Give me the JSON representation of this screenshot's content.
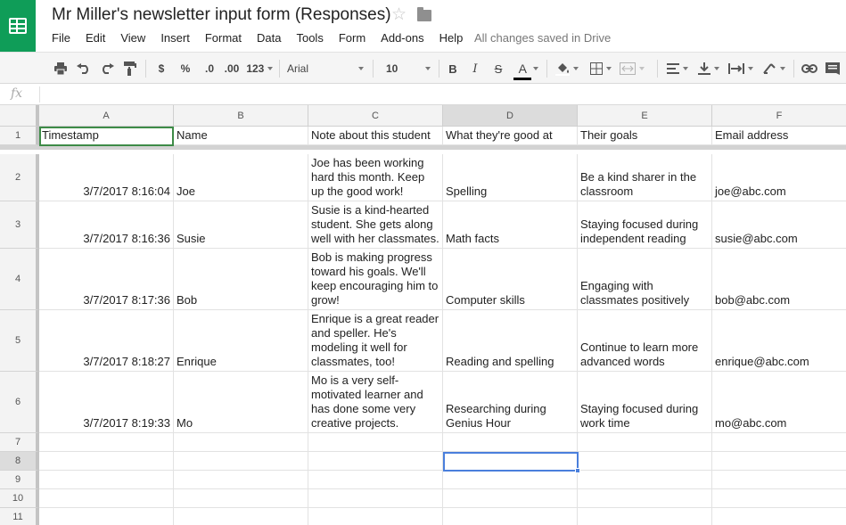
{
  "header": {
    "title": "Mr Miller's newsletter input form (Responses)",
    "save_status": "All changes saved in Drive"
  },
  "menu": [
    "File",
    "Edit",
    "View",
    "Insert",
    "Format",
    "Data",
    "Tools",
    "Form",
    "Add-ons",
    "Help"
  ],
  "toolbar": {
    "currency": "$",
    "percent": "%",
    "decrease_decimals": ".0",
    "increase_decimals": ".00",
    "more_formats": "123",
    "font": "Arial",
    "font_size": "10",
    "bold": "B",
    "italic": "I",
    "strikethrough": "S",
    "text_color": "A",
    "text_color_value": "#000000"
  },
  "formula_bar": {
    "fx": "fx",
    "content": ""
  },
  "grid": {
    "columns": [
      "A",
      "B",
      "C",
      "D",
      "E",
      "F"
    ],
    "active_column": "D",
    "active_row": "8",
    "row_numbers": [
      "1",
      "2",
      "3",
      "4",
      "5",
      "6",
      "7",
      "8",
      "9",
      "10",
      "11"
    ],
    "header_row": [
      "Timestamp",
      "Name",
      "Note about this student",
      "What they're good at",
      "Their goals",
      "Email address"
    ],
    "rows": [
      [
        "3/7/2017 8:16:04",
        "Joe",
        "Joe has been working hard this month. Keep up the good work!",
        "Spelling",
        "Be a kind sharer in the classroom",
        "joe@abc.com"
      ],
      [
        "3/7/2017 8:16:36",
        "Susie",
        "Susie is a kind-hearted student. She gets along well with her classmates.",
        "Math facts",
        "Staying focused during independent reading",
        "susie@abc.com"
      ],
      [
        "3/7/2017 8:17:36",
        "Bob",
        "Bob is making progress toward his goals. We'll keep encouraging him to grow!",
        "Computer skills",
        "Engaging with classmates positively",
        "bob@abc.com"
      ],
      [
        "3/7/2017 8:18:27",
        "Enrique",
        "Enrique is a great reader and speller. He's modeling it well for classmates, too!",
        "Reading and spelling",
        "Continue to learn more advanced words",
        "enrique@abc.com"
      ],
      [
        "3/7/2017 8:19:33",
        "Mo",
        "Mo is a very self-motivated learner and has done some very creative projects.",
        "Researching during Genius Hour",
        "Staying focused during work time",
        "mo@abc.com"
      ]
    ]
  }
}
